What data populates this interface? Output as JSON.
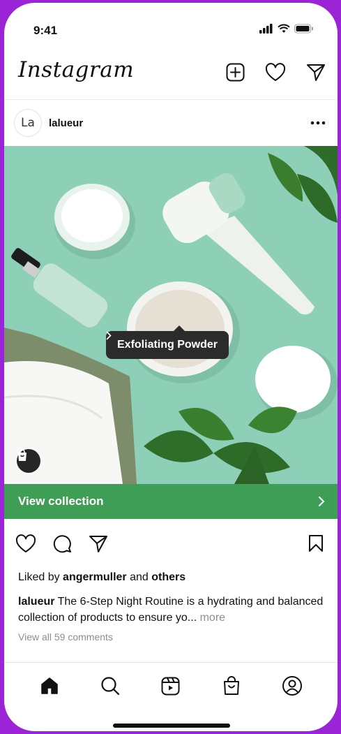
{
  "status_bar": {
    "time": "9:41"
  },
  "header": {
    "logo": "Instagram"
  },
  "post": {
    "avatar_text": "La",
    "username": "lalueur",
    "product_tag": "Exfoliating Powder",
    "collection_label": "View collection",
    "likes_prefix": "Liked by",
    "likes_user": "angermuller",
    "likes_and": "and",
    "likes_others": "others",
    "caption_user": "lalueur",
    "caption_text": "The 6-Step Night Routine is a hydrating and balanced collection of products to ensure yo...",
    "caption_more": "more",
    "comments_link": "View all 59 comments"
  },
  "colors": {
    "collection_bar": "#3f9e55",
    "image_background": "#8fd0b8",
    "frame": "#9b24d6"
  },
  "icons": {
    "header": [
      "new-post-icon",
      "heart-icon",
      "direct-message-icon"
    ],
    "actions": [
      "like-icon",
      "comment-icon",
      "share-icon",
      "save-icon"
    ],
    "tabs": [
      "home-icon",
      "search-icon",
      "reels-icon",
      "shop-icon",
      "profile-icon"
    ]
  }
}
